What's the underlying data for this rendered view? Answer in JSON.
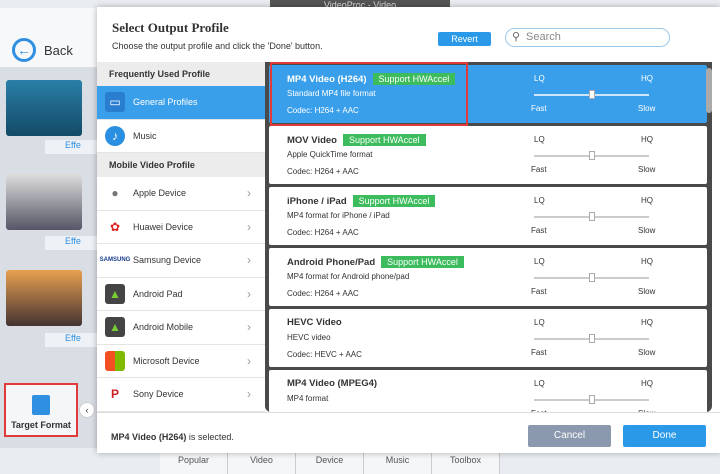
{
  "window": {
    "title": "VideoProc - Video"
  },
  "toolbar": {
    "back_label": "Back"
  },
  "left_pane": {
    "effect_label": "Effe",
    "target_format_label": "Target Format"
  },
  "bottom_tabs": [
    "Popular",
    "Video",
    "Device",
    "Music",
    "Toolbox"
  ],
  "dialog": {
    "title": "Select Output Profile",
    "subtitle": "Choose the output profile and click the 'Done' button.",
    "revert_label": "Revert",
    "search_placeholder": "Search",
    "sections": {
      "frequent": "Frequently Used Profile",
      "mobile": "Mobile Video Profile"
    },
    "frequent_items": [
      {
        "label": "General Profiles",
        "icon": "monitor-icon",
        "selected": true
      },
      {
        "label": "Music",
        "icon": "music-icon"
      }
    ],
    "mobile_items": [
      {
        "label": "Apple Device",
        "icon": "apple-icon"
      },
      {
        "label": "Huawei Device",
        "icon": "huawei-icon"
      },
      {
        "label": "Samsung Device",
        "icon": "samsung-icon"
      },
      {
        "label": "Android Pad",
        "icon": "android-icon"
      },
      {
        "label": "Android Mobile",
        "icon": "android-icon"
      },
      {
        "label": "Microsoft Device",
        "icon": "microsoft-icon"
      },
      {
        "label": "Sony Device",
        "icon": "playstation-icon"
      }
    ],
    "profiles": [
      {
        "name": "MP4 Video (H264)",
        "hw": "Support HWAccel",
        "desc": "Standard MP4 file format",
        "codec": "Codec: H264 + AAC",
        "selected": true
      },
      {
        "name": "MOV Video",
        "hw": "Support HWAccel",
        "desc": "Apple QuickTime format",
        "codec": "Codec: H264 + AAC"
      },
      {
        "name": "iPhone / iPad",
        "hw": "Support HWAccel",
        "desc": "MP4 format for iPhone / iPad",
        "codec": "Codec: H264 + AAC"
      },
      {
        "name": "Android Phone/Pad",
        "hw": "Support HWAccel",
        "desc": "MP4 format for Android phone/pad",
        "codec": "Codec: H264 + AAC"
      },
      {
        "name": "HEVC Video",
        "desc": "HEVC video",
        "codec": "Codec: HEVC + AAC"
      },
      {
        "name": "MP4 Video (MPEG4)",
        "desc": "MP4 format",
        "codec": ""
      }
    ],
    "quality": {
      "lq": "LQ",
      "hq": "HQ",
      "fast": "Fast",
      "slow": "Slow",
      "level": 0.5
    },
    "status_name": "MP4 Video (H264)",
    "status_suffix": " is selected.",
    "cancel_label": "Cancel",
    "done_label": "Done"
  }
}
